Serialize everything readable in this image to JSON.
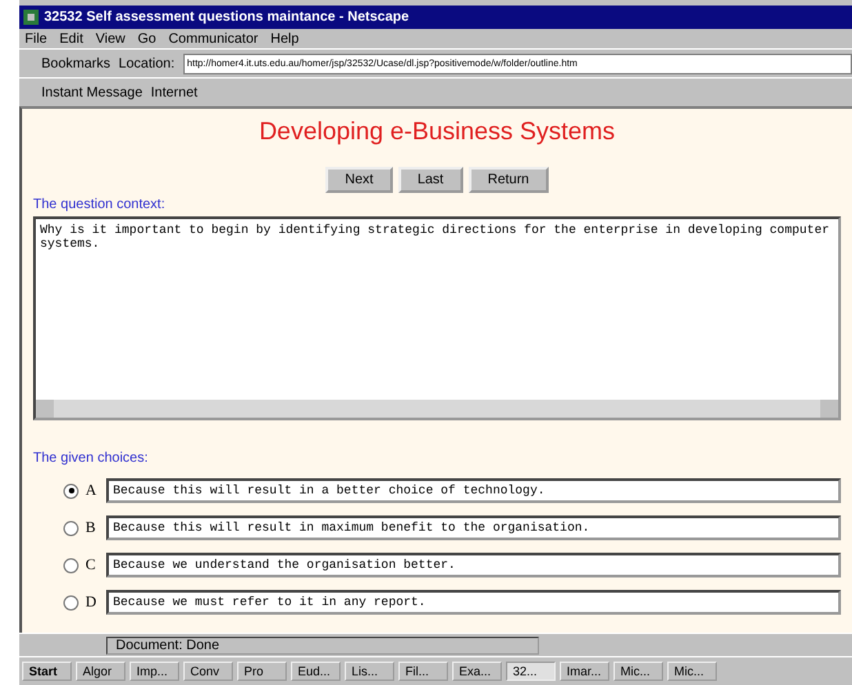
{
  "window": {
    "title": "32532 Self assessment questions maintance - Netscape"
  },
  "menu": [
    "File",
    "Edit",
    "View",
    "Go",
    "Communicator",
    "Help"
  ],
  "location_bar": {
    "bookmarks": "Bookmarks",
    "location_label": "Location:",
    "url": "http://homer4.it.uts.edu.au/homer/jsp/32532/Ucase/dl.jsp?positivemode/w/folder/outline.htm"
  },
  "personal_toolbar": [
    "Instant Message",
    "Internet"
  ],
  "page": {
    "heading": "Developing e-Business Systems",
    "buttons": [
      "Next",
      "Last",
      "Return"
    ],
    "question_label": "The question context:",
    "question": "Why is it important to begin by identifying strategic directions for the enterprise in developing computer systems.",
    "choices_label": "The given choices:",
    "choices": [
      {
        "letter": "A",
        "text": "Because this will result in a better choice of technology.",
        "selected": true
      },
      {
        "letter": "B",
        "text": "Because this will result in maximum benefit to the organisation.",
        "selected": false
      },
      {
        "letter": "C",
        "text": "Because we understand the organisation better.",
        "selected": false
      },
      {
        "letter": "D",
        "text": "Because we must refer to it in any report.",
        "selected": false
      }
    ]
  },
  "status_bar": {
    "text": "Document: Done"
  },
  "taskbar": {
    "start": "Start",
    "items": [
      {
        "label": "Algor",
        "selected": false
      },
      {
        "label": "Imp...",
        "selected": false
      },
      {
        "label": "Conv",
        "selected": false
      },
      {
        "label": "Pro",
        "selected": false
      },
      {
        "label": "Eud...",
        "selected": false
      },
      {
        "label": "Lis...",
        "selected": false
      },
      {
        "label": "Fil...",
        "selected": false
      },
      {
        "label": "Exa...",
        "selected": false
      },
      {
        "label": "32...",
        "selected": true
      },
      {
        "label": "Imar...",
        "selected": false
      },
      {
        "label": "Mic...",
        "selected": false
      },
      {
        "label": "Mic...",
        "selected": false
      }
    ]
  }
}
